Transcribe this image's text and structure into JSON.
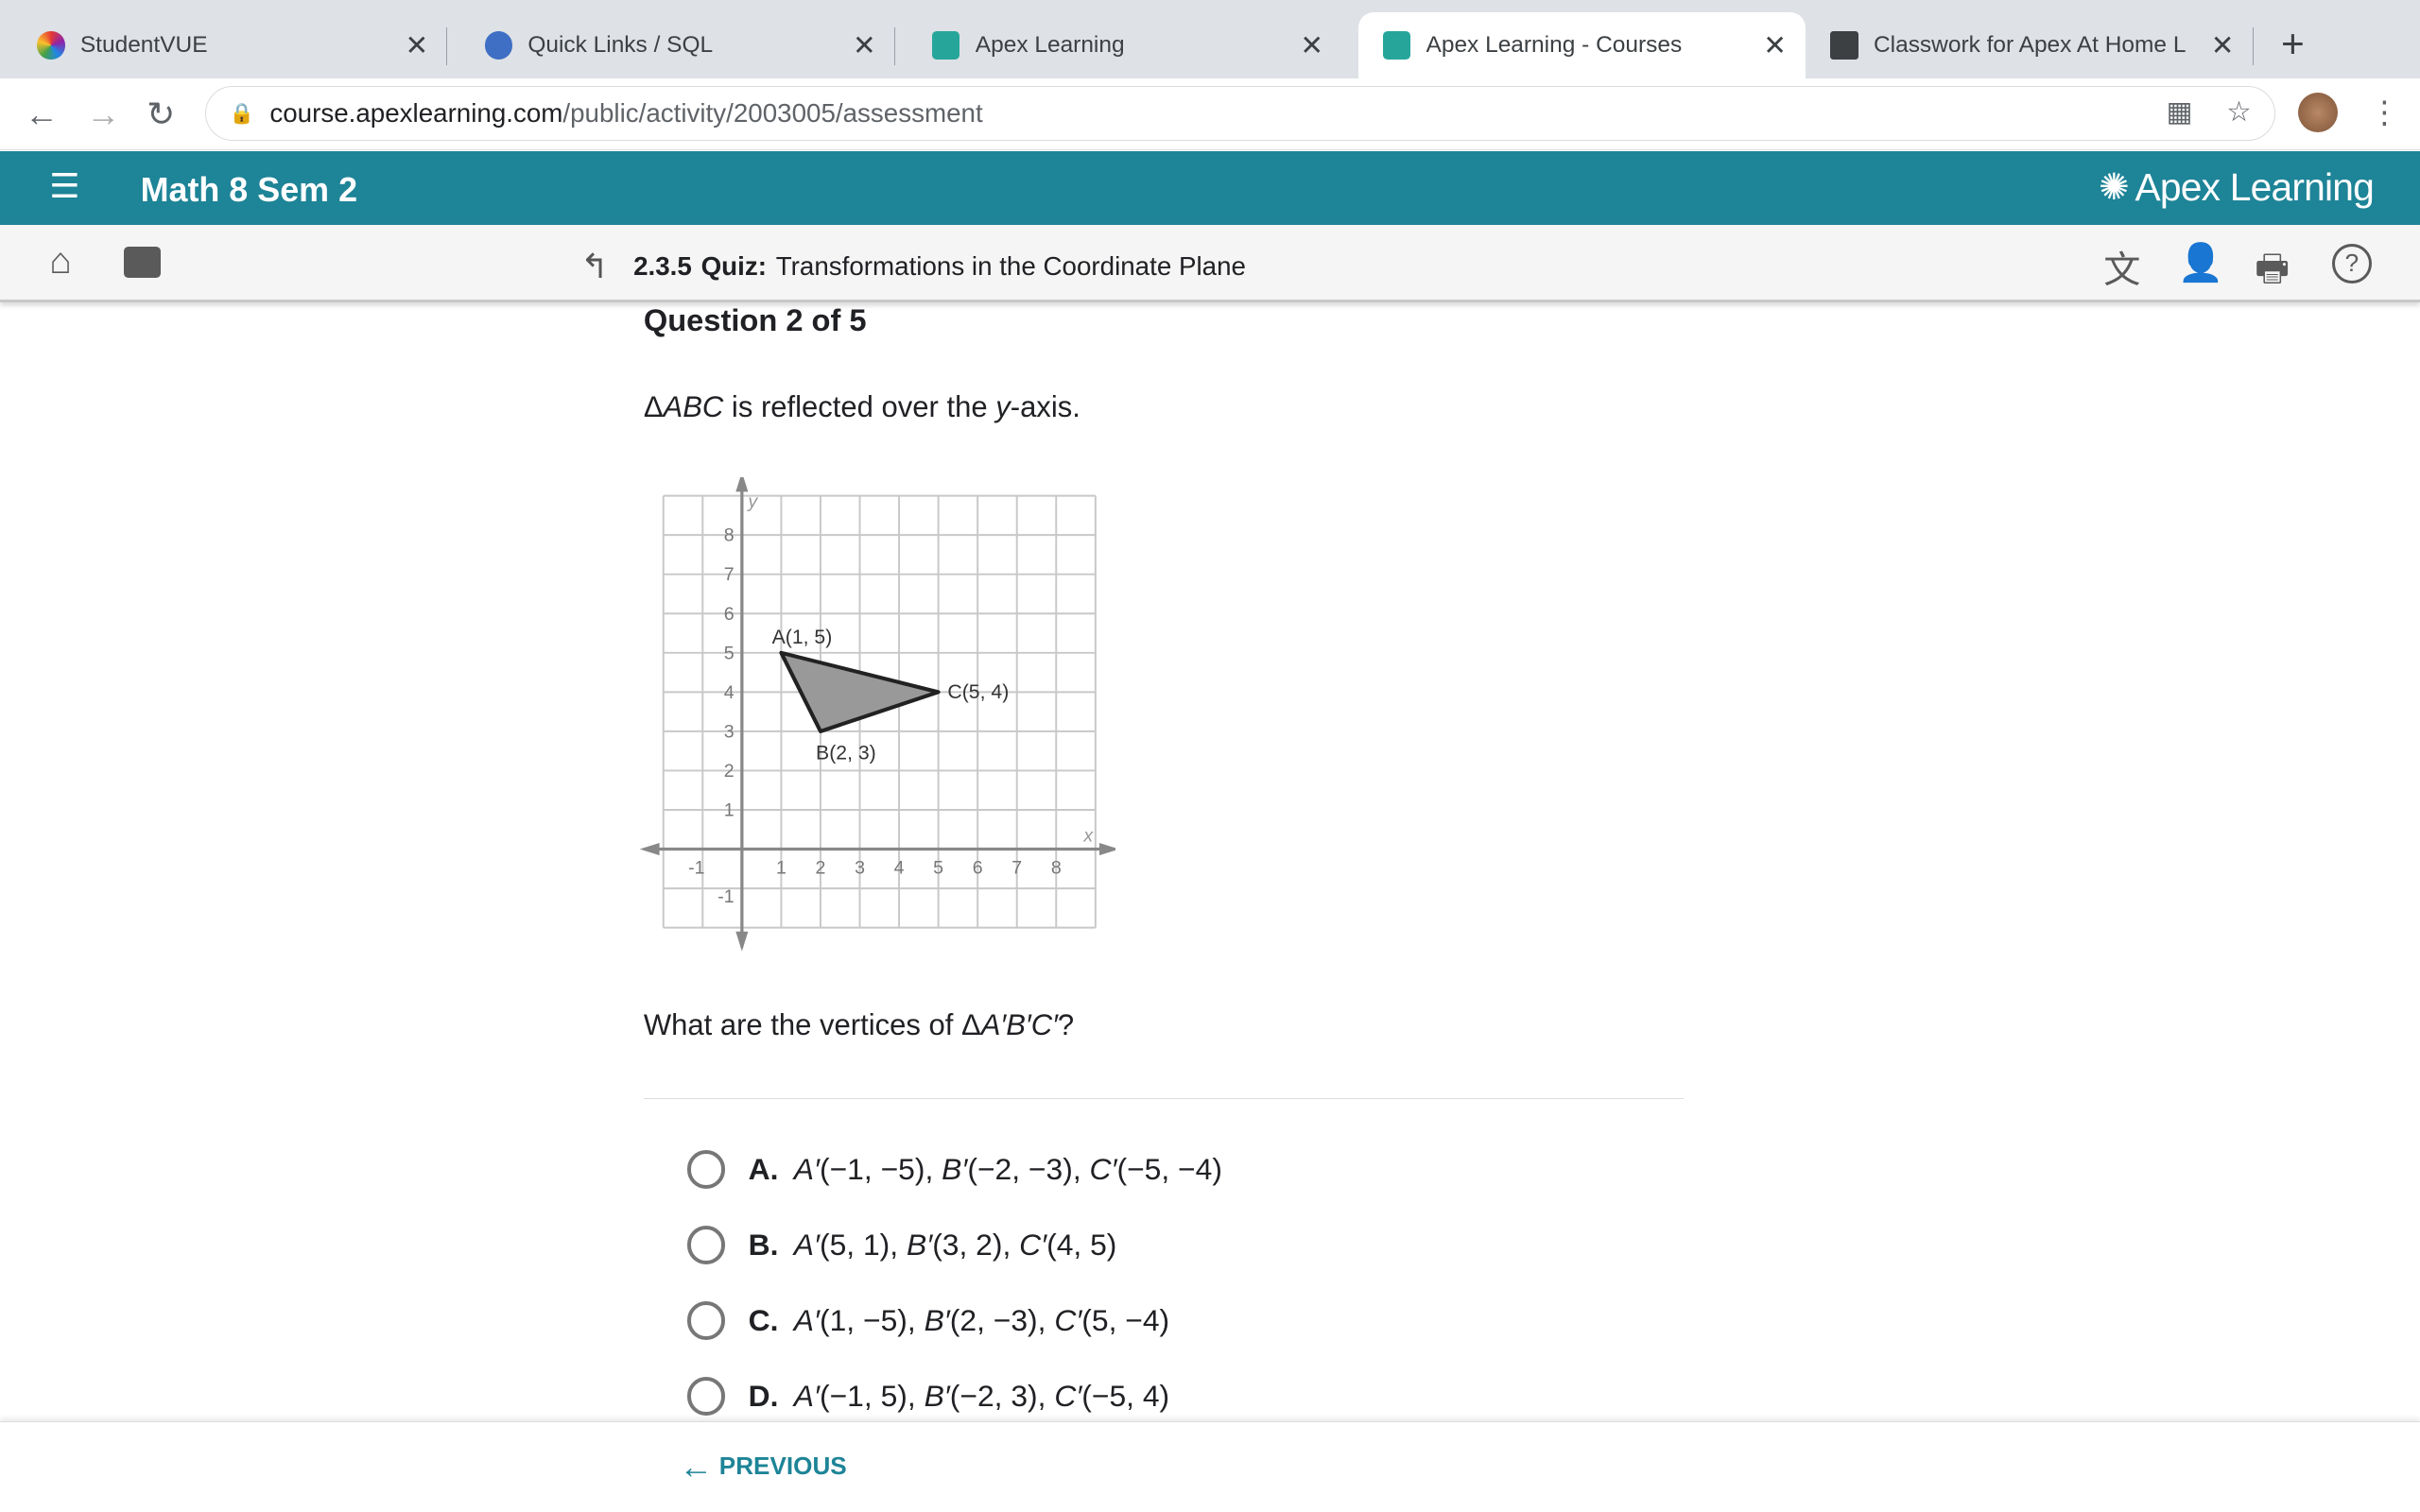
{
  "browser": {
    "tabs": [
      {
        "title": "StudentVUE",
        "active": false,
        "icon": "studentvue-icon"
      },
      {
        "title": "Quick Links / SQL",
        "active": false,
        "icon": "globe-icon"
      },
      {
        "title": "Apex Learning",
        "active": false,
        "icon": "apex-icon"
      },
      {
        "title": "Apex Learning - Courses",
        "active": true,
        "icon": "apex-icon"
      },
      {
        "title": "Classwork for Apex At Home L",
        "active": false,
        "icon": "classroom-icon"
      }
    ],
    "url_host": "course.apexlearning.com",
    "url_path": "/public/activity/2003005/assessment"
  },
  "header": {
    "course": "Math 8 Sem 2",
    "brand": "Apex Learning",
    "color": "#1e8497"
  },
  "breadcrumb": {
    "number": "2.3.5",
    "type": "Quiz:",
    "title": "Transformations in the Coordinate Plane"
  },
  "question": {
    "counter": "Question 2 of 5",
    "prompt": {
      "delta": "Δ",
      "tri": "ABC",
      "mid": " is reflected over the ",
      "axis": "y",
      "end": "-axis."
    },
    "ask": {
      "pre": "What are the vertices of Δ",
      "tri": "A′B′C′",
      "end": "?"
    },
    "graph": {
      "xlabel": "x",
      "ylabel": "y",
      "xlim": [
        -2,
        9
      ],
      "ylim": [
        -2,
        9
      ],
      "xticks": [
        "-1",
        "1",
        "2",
        "3",
        "4",
        "5",
        "6",
        "7",
        "8"
      ],
      "yticks": [
        "-1",
        "1",
        "2",
        "3",
        "4",
        "5",
        "6",
        "7",
        "8"
      ],
      "points": [
        {
          "label": "A(1, 5)",
          "x": 1,
          "y": 5
        },
        {
          "label": "B(2, 3)",
          "x": 2,
          "y": 3
        },
        {
          "label": "C(5, 4)",
          "x": 5,
          "y": 4
        }
      ]
    },
    "choices": [
      {
        "letter": "A.",
        "v": [
          {
            "n": "A′",
            "c": "(−1, −5), "
          },
          {
            "n": "B′",
            "c": "(−2, −3), "
          },
          {
            "n": "C′",
            "c": "(−5, −4)"
          }
        ]
      },
      {
        "letter": "B.",
        "v": [
          {
            "n": "A′",
            "c": "(5, 1), "
          },
          {
            "n": "B′",
            "c": "(3, 2), "
          },
          {
            "n": "C′",
            "c": "(4, 5)"
          }
        ]
      },
      {
        "letter": "C.",
        "v": [
          {
            "n": "A′",
            "c": "(1, −5), "
          },
          {
            "n": "B′",
            "c": "(2, −3), "
          },
          {
            "n": "C′",
            "c": "(5, −4)"
          }
        ]
      },
      {
        "letter": "D.",
        "v": [
          {
            "n": "A′",
            "c": "(−1, 5), "
          },
          {
            "n": "B′",
            "c": "(−2, 3), "
          },
          {
            "n": "C′",
            "c": "(−5, 4)"
          }
        ]
      }
    ]
  },
  "footer": {
    "previous": "PREVIOUS"
  }
}
